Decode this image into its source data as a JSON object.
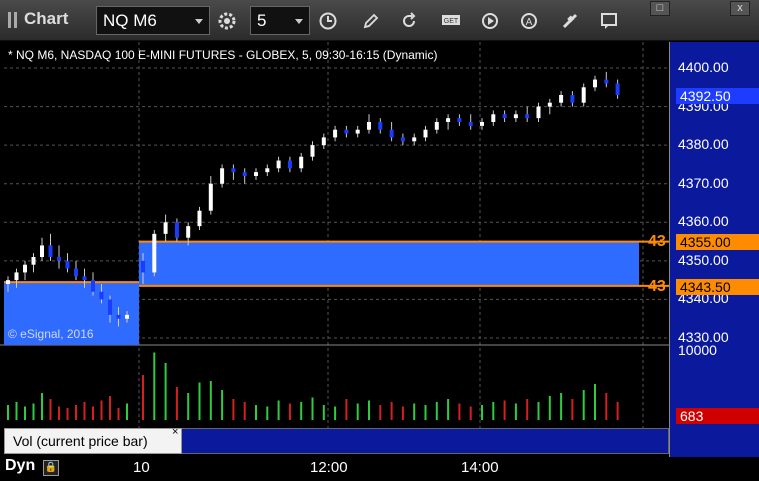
{
  "toolbar": {
    "title": "Chart",
    "symbol": "NQ M6",
    "interval": "5",
    "icons": [
      "settings-gear-icon",
      "clock-icon",
      "draw-pencil-icon",
      "refresh-icon",
      "get-icon",
      "play-icon",
      "alert-icon",
      "link-icon",
      "comment-icon"
    ]
  },
  "window": {
    "restore": "□",
    "close": "x"
  },
  "chart": {
    "description": "* NQ M6, NASDAQ 100 E-MINI FUTURES - GLOBEX, 5, 09:30-16:15 (Dynamic)",
    "copyright": "© eSignal, 2016",
    "price_ticks": [
      "4400.00",
      "4390.00",
      "4380.00",
      "4370.00",
      "4360.00",
      "4350.00",
      "4340.00",
      "4330.00"
    ],
    "last_price": "4392.50",
    "level_high": "4355.00",
    "level_low": "4343.50",
    "level_high_side": "43",
    "level_low_side": "43",
    "volume_max_tick": "10000",
    "volume_last": "683",
    "volume_panel_label": "Vol (current price bar)",
    "volume_close": "×",
    "time_labels": [
      "10",
      "12:00",
      "14:00"
    ],
    "dyn_label": "Dyn",
    "colors": {
      "up": "#ffffff",
      "down": "#1a3cff",
      "zone": "#2f6bff",
      "level": "#ff8c00",
      "vol_up": "#2ecc40",
      "vol_down": "#d61f1f"
    }
  },
  "chart_data": {
    "type": "candlestick",
    "ylim": [
      4330,
      4402
    ],
    "candles": [
      [
        4344,
        4346,
        4342,
        4345
      ],
      [
        4345,
        4348,
        4343,
        4347
      ],
      [
        4347,
        4350,
        4345,
        4349
      ],
      [
        4349,
        4352,
        4347,
        4351
      ],
      [
        4351,
        4356,
        4350,
        4354
      ],
      [
        4354,
        4357,
        4350,
        4351
      ],
      [
        4351,
        4354,
        4348,
        4350
      ],
      [
        4350,
        4352,
        4347,
        4348
      ],
      [
        4348,
        4350,
        4345,
        4346
      ],
      [
        4346,
        4348,
        4343,
        4345
      ],
      [
        4345,
        4347,
        4341,
        4342
      ],
      [
        4342,
        4344,
        4339,
        4340
      ],
      [
        4340,
        4341,
        4334,
        4336
      ],
      [
        4336,
        4338,
        4333,
        4335
      ],
      [
        4335,
        4337,
        4334,
        4336
      ],
      [
        4350,
        4352,
        4344,
        4347
      ],
      [
        4347,
        4358,
        4346,
        4357
      ],
      [
        4357,
        4362,
        4355,
        4360
      ],
      [
        4360,
        4361,
        4355,
        4356
      ],
      [
        4356,
        4360,
        4354,
        4359
      ],
      [
        4359,
        4364,
        4358,
        4363
      ],
      [
        4363,
        4372,
        4362,
        4370
      ],
      [
        4370,
        4375,
        4369,
        4374
      ],
      [
        4374,
        4375,
        4371,
        4373
      ],
      [
        4373,
        4374,
        4370,
        4372
      ],
      [
        4372,
        4374,
        4371,
        4373
      ],
      [
        4373,
        4375,
        4372,
        4374
      ],
      [
        4374,
        4377,
        4373,
        4376
      ],
      [
        4376,
        4377,
        4373,
        4374
      ],
      [
        4374,
        4378,
        4373,
        4377
      ],
      [
        4377,
        4381,
        4376,
        4380
      ],
      [
        4380,
        4383,
        4379,
        4382
      ],
      [
        4382,
        4385,
        4381,
        4384
      ],
      [
        4384,
        4385,
        4382,
        4383
      ],
      [
        4383,
        4385,
        4382,
        4384
      ],
      [
        4384,
        4388,
        4383,
        4386
      ],
      [
        4386,
        4387,
        4383,
        4384
      ],
      [
        4384,
        4386,
        4381,
        4382
      ],
      [
        4382,
        4383,
        4380,
        4381
      ],
      [
        4381,
        4383,
        4380,
        4382
      ],
      [
        4382,
        4385,
        4381,
        4384
      ],
      [
        4384,
        4387,
        4383,
        4386
      ],
      [
        4386,
        4388,
        4384,
        4387
      ],
      [
        4387,
        4388,
        4385,
        4386
      ],
      [
        4386,
        4388,
        4384,
        4385
      ],
      [
        4385,
        4387,
        4384,
        4386
      ],
      [
        4386,
        4389,
        4385,
        4388
      ],
      [
        4388,
        4389,
        4386,
        4387
      ],
      [
        4387,
        4389,
        4386,
        4388
      ],
      [
        4388,
        4390,
        4386,
        4387
      ],
      [
        4387,
        4391,
        4386,
        4390
      ],
      [
        4390,
        4392,
        4388,
        4391
      ],
      [
        4391,
        4394,
        4390,
        4393
      ],
      [
        4393,
        4394,
        4390,
        4391
      ],
      [
        4391,
        4396,
        4390,
        4395
      ],
      [
        4395,
        4398,
        4394,
        4397
      ],
      [
        4397,
        4399,
        4395,
        4396
      ],
      [
        4396,
        4397,
        4392,
        4393
      ]
    ],
    "volume": [
      10,
      12,
      9,
      11,
      18,
      14,
      9,
      8,
      10,
      12,
      9,
      13,
      16,
      8,
      11,
      30,
      45,
      38,
      22,
      18,
      25,
      26,
      20,
      14,
      12,
      10,
      9,
      13,
      11,
      12,
      15,
      10,
      9,
      14,
      11,
      13,
      10,
      12,
      9,
      11,
      10,
      12,
      14,
      11,
      9,
      10,
      12,
      13,
      11,
      14,
      12,
      16,
      18,
      14,
      20,
      24,
      18,
      12
    ],
    "volume_up": [
      1,
      1,
      1,
      1,
      1,
      0,
      0,
      0,
      0,
      0,
      0,
      0,
      0,
      0,
      1,
      0,
      1,
      1,
      0,
      1,
      1,
      1,
      1,
      0,
      0,
      1,
      1,
      1,
      0,
      1,
      1,
      1,
      1,
      0,
      1,
      1,
      0,
      0,
      0,
      1,
      1,
      1,
      1,
      0,
      0,
      1,
      1,
      0,
      1,
      0,
      1,
      1,
      1,
      0,
      1,
      1,
      0,
      0
    ]
  }
}
